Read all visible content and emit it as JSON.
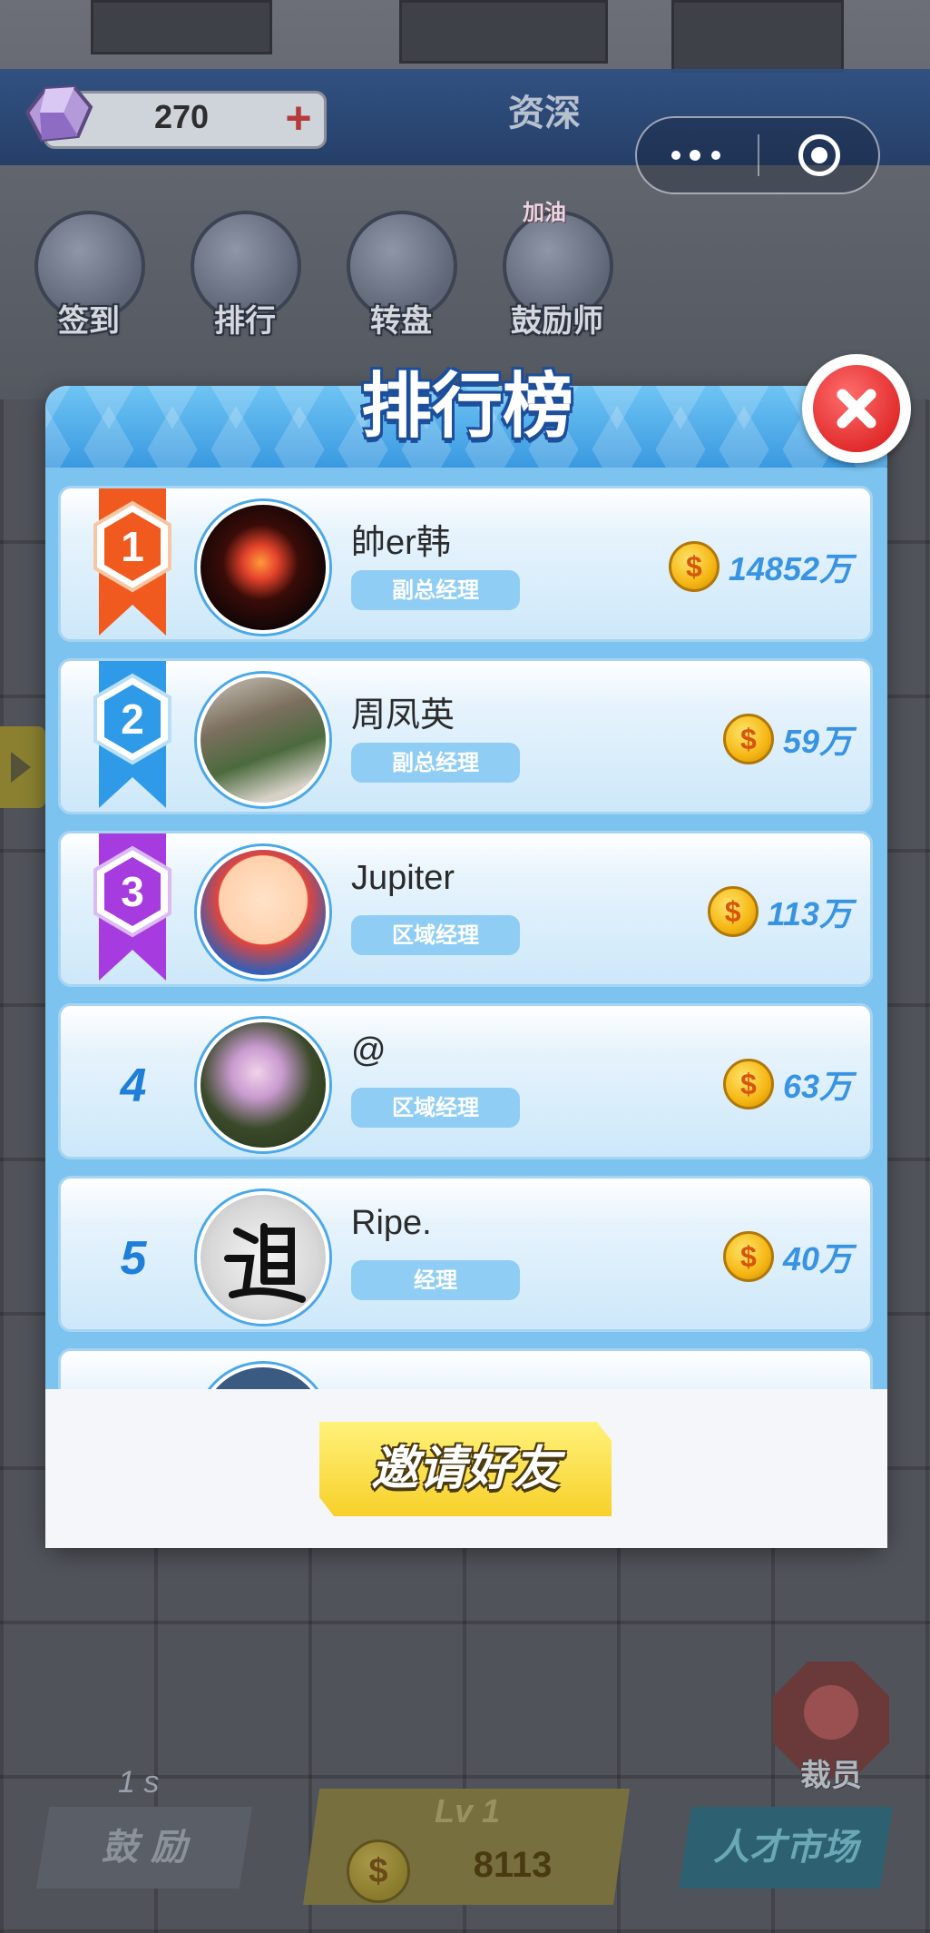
{
  "top_bar": {
    "gem_count": "270",
    "plus_label": "+",
    "rank_title": "资深"
  },
  "features": [
    {
      "label": "签到",
      "icon": "scroll-icon"
    },
    {
      "label": "排行",
      "icon": "podium-icon"
    },
    {
      "label": "转盘",
      "icon": "wheel-icon"
    },
    {
      "label": "鼓励师",
      "icon": "cheerleader-icon",
      "badge": "加油"
    }
  ],
  "modal": {
    "title": "排行榜",
    "invite_label": "邀请好友",
    "rows": [
      {
        "rank": "1",
        "name": "帥er韩",
        "title": "副总经理",
        "score": "14852万",
        "ribbon_color": "#f05a1e"
      },
      {
        "rank": "2",
        "name": "周凤英",
        "title": "副总经理",
        "score": "59万",
        "ribbon_color": "#2f9be8"
      },
      {
        "rank": "3",
        "name": "Jupiter",
        "title": "区域经理",
        "score": "113万",
        "ribbon_color": "#a63be0"
      },
      {
        "rank": "4",
        "name": "@",
        "title": "区域经理",
        "score": "63万"
      },
      {
        "rank": "5",
        "name": "Ripe.",
        "title": "经理",
        "score": "40万"
      }
    ]
  },
  "bottom": {
    "timer": "1 s",
    "encourage_label": "鼓 励",
    "level_label": "Lv 1",
    "gold_value": "8113",
    "market_label": "人才市场",
    "fire_label": "裁员"
  },
  "colors": {
    "primary_blue": "#3a99e0",
    "score_blue": "#3894e2",
    "invite_yellow": "#f7d02a",
    "close_red": "#e22d2d"
  }
}
